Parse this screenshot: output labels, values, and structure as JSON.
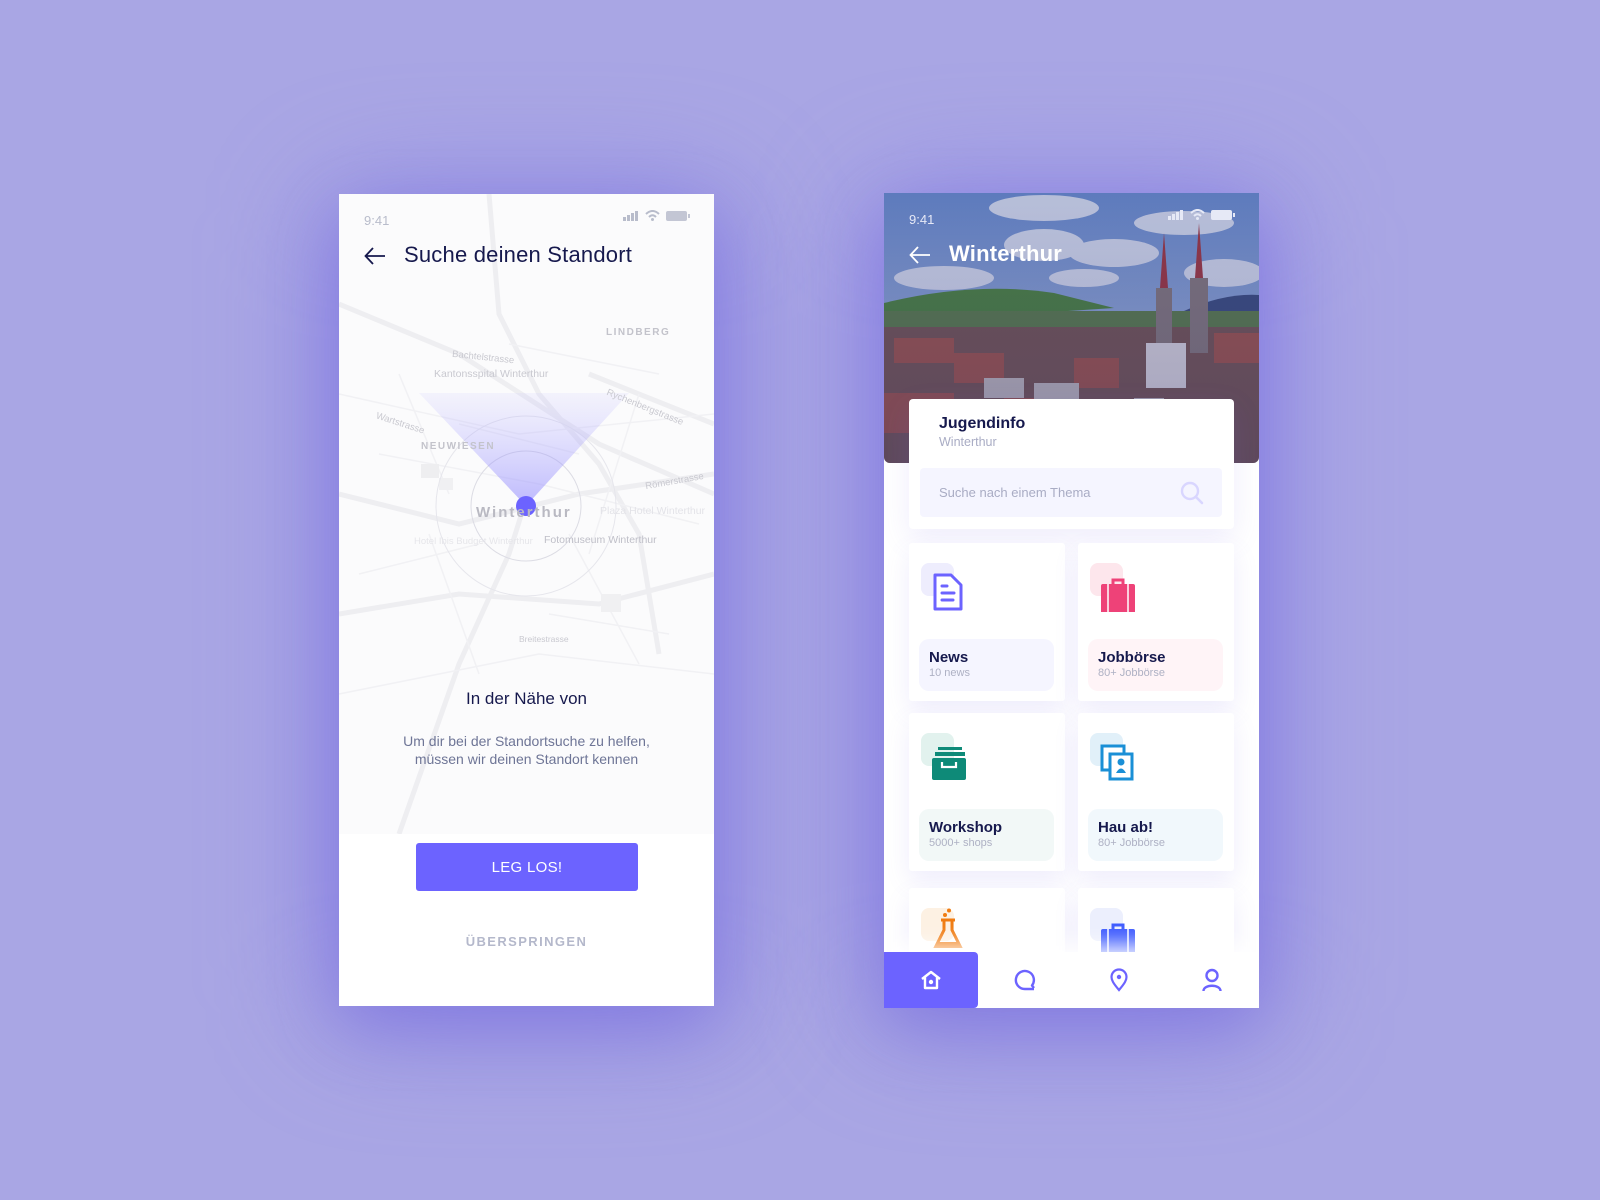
{
  "colors": {
    "background": "#a9a6e4",
    "accent": "#6c63ff",
    "text_dark": "#16194d"
  },
  "location_screen": {
    "status_time": "9:41",
    "title": "Suche deinen Standort",
    "map_labels": {
      "lindberg": "LINDBERG",
      "bachtelstrasse": "Bachtelstrasse",
      "kantonsspital": "Kantonsspital Winterthur",
      "rychenbergstrasse": "Rychenbergstrasse",
      "wartstrasse": "Wartstrasse",
      "neuwiesen": "NEUWIESEN",
      "roemerstrasse": "Römerstrasse",
      "winterthur": "Winterthur",
      "plaza": "Plaza Hotel Winterthur",
      "fotomuseum": "Fotomuseum Winterthur",
      "breitestrasse": "Breitestrasse",
      "hotel_ibis": "Hotel Ibis Budget Winterthur"
    },
    "heading": "In der Nähe von",
    "description_line1": "Um dir bei der Standortsuche zu helfen,",
    "description_line2": "müssen wir deinen Standort kennen",
    "primary_button": "LEG LOS!",
    "skip_link": "ÜBERSPRINGEN"
  },
  "home_screen": {
    "status_time": "9:41",
    "title": "Winterthur",
    "info_card": {
      "title": "Jugendinfo",
      "subtitle": "Winterthur"
    },
    "search": {
      "placeholder": "Suche nach einem Thema",
      "value": ""
    },
    "tiles": [
      {
        "title": "News",
        "subtitle": "10 news",
        "icon": "document-icon",
        "color": "#6c63ff"
      },
      {
        "title": "Jobbörse",
        "subtitle": "80+ Jobbörse",
        "icon": "briefcase-icon",
        "color": "#ee4278"
      },
      {
        "title": "Workshop",
        "subtitle": "5000+ shops",
        "icon": "archive-box-icon",
        "color": "#0e8a78"
      },
      {
        "title": "Hau ab!",
        "subtitle": "80+ Jobbörse",
        "icon": "photo-id-icon",
        "color": "#1a8fd6"
      },
      {
        "title": "",
        "subtitle": "",
        "icon": "flask-icon",
        "color": "#f07c12"
      },
      {
        "title": "",
        "subtitle": "",
        "icon": "briefcase-icon",
        "color": "#3d5afe"
      }
    ],
    "nav": [
      {
        "icon": "home-icon",
        "active": true
      },
      {
        "icon": "chat-icon",
        "active": false
      },
      {
        "icon": "location-pin-icon",
        "active": false
      },
      {
        "icon": "user-icon",
        "active": false
      }
    ]
  }
}
